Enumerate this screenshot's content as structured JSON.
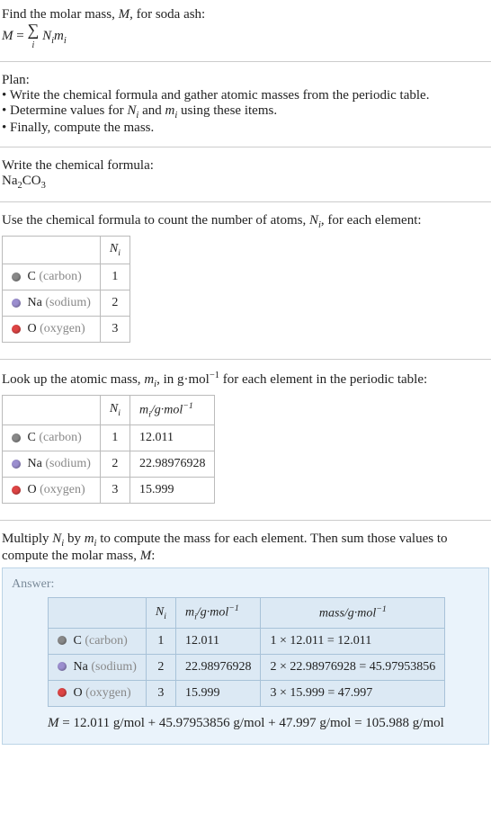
{
  "intro": {
    "line1_a": "Find the molar mass, ",
    "line1_b": ", for soda ash:",
    "eq_lhs": "M",
    "eq_eq": " = ",
    "eq_sum": "∑",
    "eq_sumsub": "i",
    "eq_rhs_a": "N",
    "eq_rhs_b": "m"
  },
  "plan": {
    "title": "Plan:",
    "b1": "• Write the chemical formula and gather atomic masses from the periodic table.",
    "b2_a": "• Determine values for ",
    "b2_b": " and ",
    "b2_c": " using these items.",
    "b3": "• Finally, compute the mass."
  },
  "chem": {
    "line1": "Write the chemical formula:",
    "formula": "Na",
    "formula_s1": "2",
    "formula_mid": "CO",
    "formula_s2": "3"
  },
  "count": {
    "line_a": "Use the chemical formula to count the number of atoms, ",
    "line_b": ", for each element:",
    "header": "N",
    "rows": [
      {
        "dot": "dot-c",
        "sym": "C",
        "name": "(carbon)",
        "n": "1"
      },
      {
        "dot": "dot-na",
        "sym": "Na",
        "name": "(sodium)",
        "n": "2"
      },
      {
        "dot": "dot-o",
        "sym": "O",
        "name": "(oxygen)",
        "n": "3"
      }
    ]
  },
  "mass": {
    "line_a": "Look up the atomic mass, ",
    "line_b": ", in g·mol",
    "line_c": " for each element in the periodic table:",
    "exp": "−1",
    "h1": "N",
    "h2_a": "m",
    "h2_b": "/g·mol",
    "rows": [
      {
        "dot": "dot-c",
        "sym": "C",
        "name": "(carbon)",
        "n": "1",
        "m": "12.011"
      },
      {
        "dot": "dot-na",
        "sym": "Na",
        "name": "(sodium)",
        "n": "2",
        "m": "22.98976928"
      },
      {
        "dot": "dot-o",
        "sym": "O",
        "name": "(oxygen)",
        "n": "3",
        "m": "15.999"
      }
    ]
  },
  "mult": {
    "line_a": "Multiply ",
    "line_b": " by ",
    "line_c": " to compute the mass for each element. Then sum those values to compute the molar mass, ",
    "line_d": ":"
  },
  "answer": {
    "label": "Answer:",
    "h1": "N",
    "h2_a": "m",
    "h2_b": "/g·mol",
    "h3": "mass/g·mol",
    "exp": "−1",
    "rows": [
      {
        "dot": "dot-c",
        "sym": "C",
        "name": "(carbon)",
        "n": "1",
        "m": "12.011",
        "calc": "1 × 12.011 = 12.011"
      },
      {
        "dot": "dot-na",
        "sym": "Na",
        "name": "(sodium)",
        "n": "2",
        "m": "22.98976928",
        "calc": "2 × 22.98976928 = 45.97953856"
      },
      {
        "dot": "dot-o",
        "sym": "O",
        "name": "(oxygen)",
        "n": "3",
        "m": "15.999",
        "calc": "3 × 15.999 = 47.997"
      }
    ],
    "final_a": "M",
    "final_b": " = 12.011 g/mol + 45.97953856 g/mol + 47.997 g/mol = 105.988 g/mol"
  },
  "sym": {
    "N": "N",
    "m": "m",
    "M": "M",
    "i": "i"
  }
}
